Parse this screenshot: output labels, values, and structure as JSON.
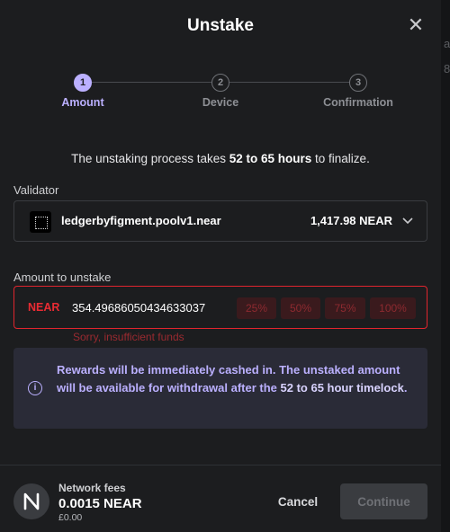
{
  "modal": {
    "title": "Unstake"
  },
  "steps": [
    {
      "number": "1",
      "label": "Amount",
      "state": "active"
    },
    {
      "number": "2",
      "label": "Device",
      "state": "idle"
    },
    {
      "number": "3",
      "label": "Confirmation",
      "state": "idle"
    }
  ],
  "info": {
    "prefix": "The unstaking process takes ",
    "duration": "52 to 65 hours",
    "suffix": " to finalize."
  },
  "validator": {
    "label": "Validator",
    "name": "ledgerbyfigment.poolv1.near",
    "balance": "1,417.98 NEAR",
    "icon": "figment-logo-icon"
  },
  "amount": {
    "label": "Amount to unstake",
    "ticker": "NEAR",
    "value": "354.49686050434633037",
    "percent_buttons": [
      "25%",
      "50%",
      "75%",
      "100%"
    ],
    "error": "Sorry, insufficient funds"
  },
  "notice": {
    "icon": "info-icon",
    "text_before": "Rewards will be immediately cashed in. The unstaked amount will be available for withdrawal after the ",
    "emphasis_1": "52 to 65 hour",
    "emphasis_2": "timelock",
    "text_after": "."
  },
  "footer": {
    "fee_label": "Network fees",
    "fee_amount": "0.0015 NEAR",
    "fee_fiat": "£0.00",
    "cancel_label": "Cancel",
    "continue_label": "Continue"
  },
  "background_edge": {
    "line_1": "a",
    "line_2": "8"
  },
  "colors": {
    "accent": "#bbb0ff",
    "error": "#e0252e",
    "background": "#1c1d1f"
  }
}
